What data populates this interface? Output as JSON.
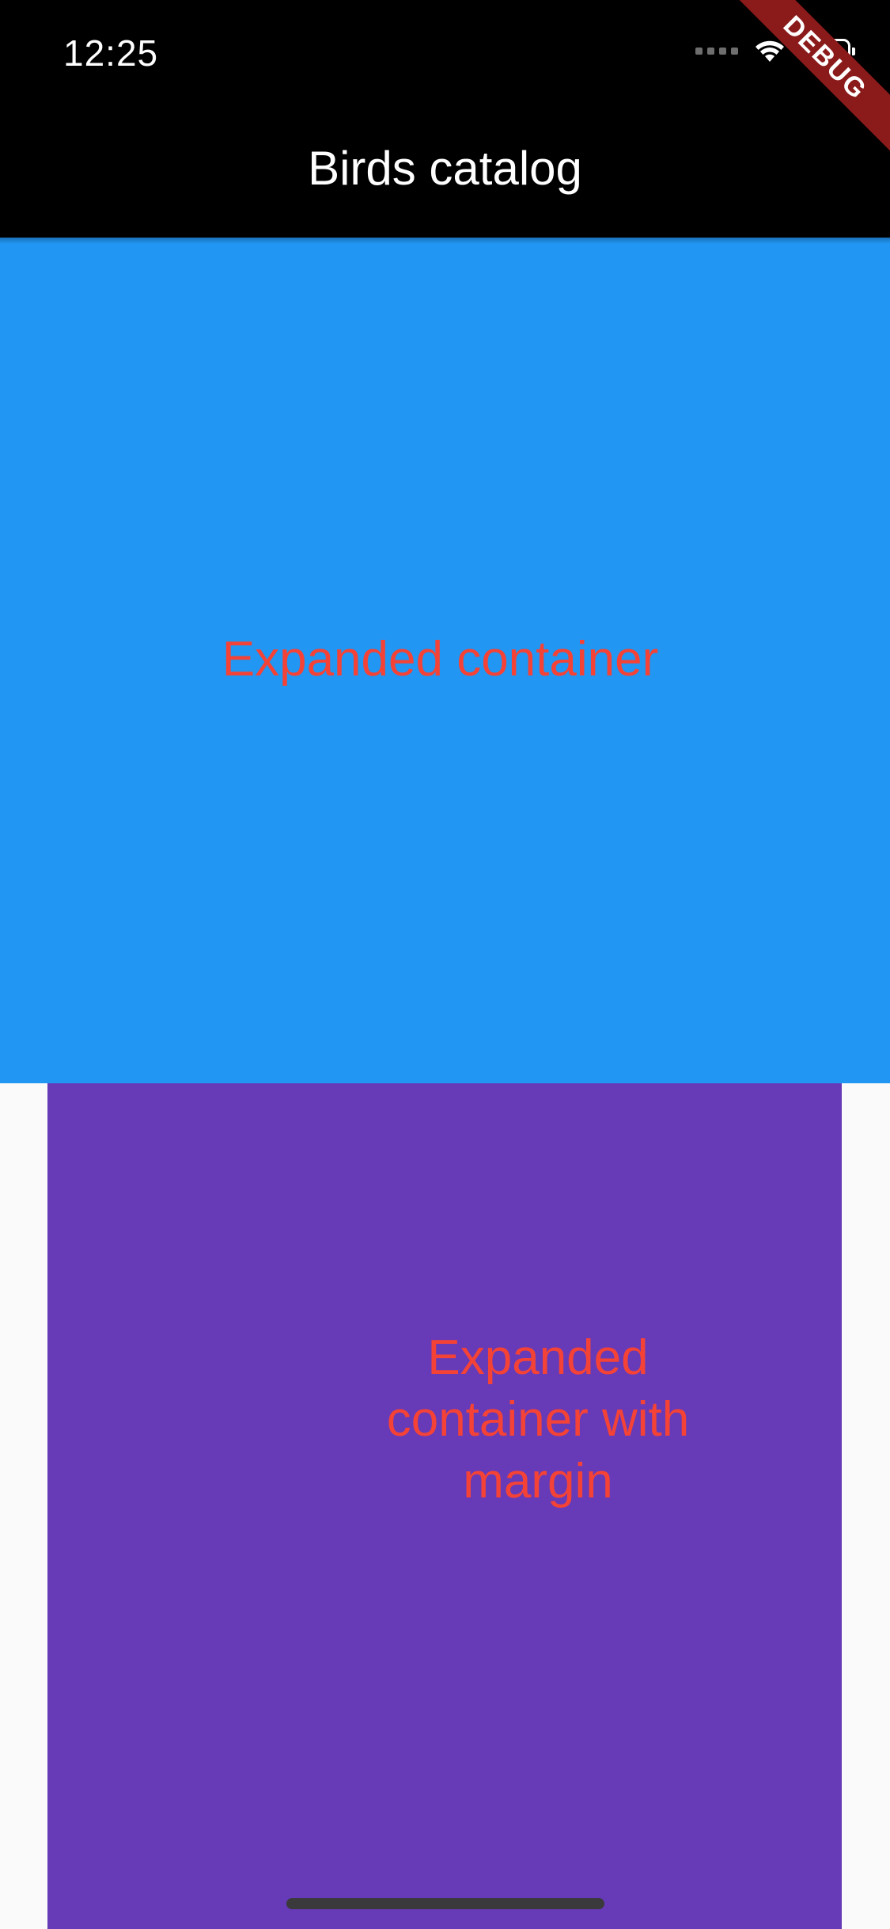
{
  "status_bar": {
    "time": "12:25"
  },
  "app_bar": {
    "title": "Birds catalog"
  },
  "debug_banner": {
    "label": "DEBUG"
  },
  "containers": {
    "expanded": {
      "label": "Expanded container",
      "background_color": "#2196f3",
      "text_color": "#f44336"
    },
    "expanded_with_margin": {
      "label": "Expanded\ncontainer with\nmargin",
      "background_color": "#673ab7",
      "text_color": "#f44336"
    }
  },
  "icons": {
    "signal": "cellular-signal-icon",
    "wifi": "wifi-icon",
    "battery": "battery-icon"
  }
}
